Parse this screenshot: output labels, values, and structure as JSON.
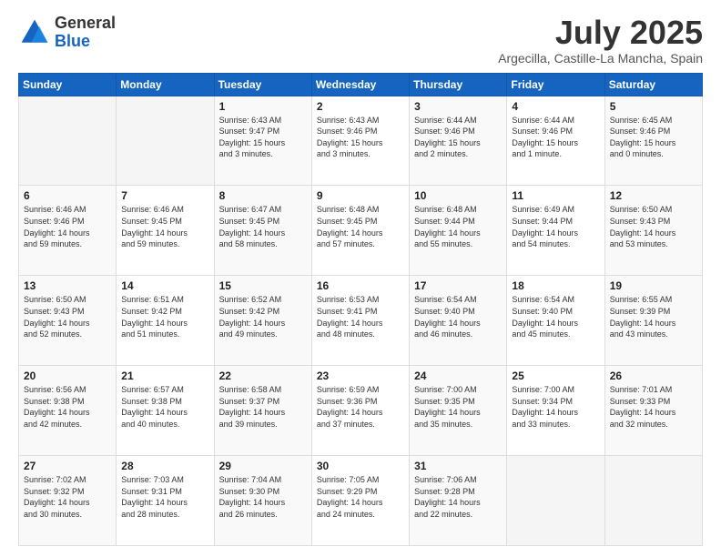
{
  "logo": {
    "general": "General",
    "blue": "Blue"
  },
  "header": {
    "title": "July 2025",
    "subtitle": "Argecilla, Castille-La Mancha, Spain"
  },
  "weekdays": [
    "Sunday",
    "Monday",
    "Tuesday",
    "Wednesday",
    "Thursday",
    "Friday",
    "Saturday"
  ],
  "weeks": [
    [
      {
        "day": "",
        "detail": ""
      },
      {
        "day": "",
        "detail": ""
      },
      {
        "day": "1",
        "detail": "Sunrise: 6:43 AM\nSunset: 9:47 PM\nDaylight: 15 hours\nand 3 minutes."
      },
      {
        "day": "2",
        "detail": "Sunrise: 6:43 AM\nSunset: 9:46 PM\nDaylight: 15 hours\nand 3 minutes."
      },
      {
        "day": "3",
        "detail": "Sunrise: 6:44 AM\nSunset: 9:46 PM\nDaylight: 15 hours\nand 2 minutes."
      },
      {
        "day": "4",
        "detail": "Sunrise: 6:44 AM\nSunset: 9:46 PM\nDaylight: 15 hours\nand 1 minute."
      },
      {
        "day": "5",
        "detail": "Sunrise: 6:45 AM\nSunset: 9:46 PM\nDaylight: 15 hours\nand 0 minutes."
      }
    ],
    [
      {
        "day": "6",
        "detail": "Sunrise: 6:46 AM\nSunset: 9:46 PM\nDaylight: 14 hours\nand 59 minutes."
      },
      {
        "day": "7",
        "detail": "Sunrise: 6:46 AM\nSunset: 9:45 PM\nDaylight: 14 hours\nand 59 minutes."
      },
      {
        "day": "8",
        "detail": "Sunrise: 6:47 AM\nSunset: 9:45 PM\nDaylight: 14 hours\nand 58 minutes."
      },
      {
        "day": "9",
        "detail": "Sunrise: 6:48 AM\nSunset: 9:45 PM\nDaylight: 14 hours\nand 57 minutes."
      },
      {
        "day": "10",
        "detail": "Sunrise: 6:48 AM\nSunset: 9:44 PM\nDaylight: 14 hours\nand 55 minutes."
      },
      {
        "day": "11",
        "detail": "Sunrise: 6:49 AM\nSunset: 9:44 PM\nDaylight: 14 hours\nand 54 minutes."
      },
      {
        "day": "12",
        "detail": "Sunrise: 6:50 AM\nSunset: 9:43 PM\nDaylight: 14 hours\nand 53 minutes."
      }
    ],
    [
      {
        "day": "13",
        "detail": "Sunrise: 6:50 AM\nSunset: 9:43 PM\nDaylight: 14 hours\nand 52 minutes."
      },
      {
        "day": "14",
        "detail": "Sunrise: 6:51 AM\nSunset: 9:42 PM\nDaylight: 14 hours\nand 51 minutes."
      },
      {
        "day": "15",
        "detail": "Sunrise: 6:52 AM\nSunset: 9:42 PM\nDaylight: 14 hours\nand 49 minutes."
      },
      {
        "day": "16",
        "detail": "Sunrise: 6:53 AM\nSunset: 9:41 PM\nDaylight: 14 hours\nand 48 minutes."
      },
      {
        "day": "17",
        "detail": "Sunrise: 6:54 AM\nSunset: 9:40 PM\nDaylight: 14 hours\nand 46 minutes."
      },
      {
        "day": "18",
        "detail": "Sunrise: 6:54 AM\nSunset: 9:40 PM\nDaylight: 14 hours\nand 45 minutes."
      },
      {
        "day": "19",
        "detail": "Sunrise: 6:55 AM\nSunset: 9:39 PM\nDaylight: 14 hours\nand 43 minutes."
      }
    ],
    [
      {
        "day": "20",
        "detail": "Sunrise: 6:56 AM\nSunset: 9:38 PM\nDaylight: 14 hours\nand 42 minutes."
      },
      {
        "day": "21",
        "detail": "Sunrise: 6:57 AM\nSunset: 9:38 PM\nDaylight: 14 hours\nand 40 minutes."
      },
      {
        "day": "22",
        "detail": "Sunrise: 6:58 AM\nSunset: 9:37 PM\nDaylight: 14 hours\nand 39 minutes."
      },
      {
        "day": "23",
        "detail": "Sunrise: 6:59 AM\nSunset: 9:36 PM\nDaylight: 14 hours\nand 37 minutes."
      },
      {
        "day": "24",
        "detail": "Sunrise: 7:00 AM\nSunset: 9:35 PM\nDaylight: 14 hours\nand 35 minutes."
      },
      {
        "day": "25",
        "detail": "Sunrise: 7:00 AM\nSunset: 9:34 PM\nDaylight: 14 hours\nand 33 minutes."
      },
      {
        "day": "26",
        "detail": "Sunrise: 7:01 AM\nSunset: 9:33 PM\nDaylight: 14 hours\nand 32 minutes."
      }
    ],
    [
      {
        "day": "27",
        "detail": "Sunrise: 7:02 AM\nSunset: 9:32 PM\nDaylight: 14 hours\nand 30 minutes."
      },
      {
        "day": "28",
        "detail": "Sunrise: 7:03 AM\nSunset: 9:31 PM\nDaylight: 14 hours\nand 28 minutes."
      },
      {
        "day": "29",
        "detail": "Sunrise: 7:04 AM\nSunset: 9:30 PM\nDaylight: 14 hours\nand 26 minutes."
      },
      {
        "day": "30",
        "detail": "Sunrise: 7:05 AM\nSunset: 9:29 PM\nDaylight: 14 hours\nand 24 minutes."
      },
      {
        "day": "31",
        "detail": "Sunrise: 7:06 AM\nSunset: 9:28 PM\nDaylight: 14 hours\nand 22 minutes."
      },
      {
        "day": "",
        "detail": ""
      },
      {
        "day": "",
        "detail": ""
      }
    ]
  ]
}
